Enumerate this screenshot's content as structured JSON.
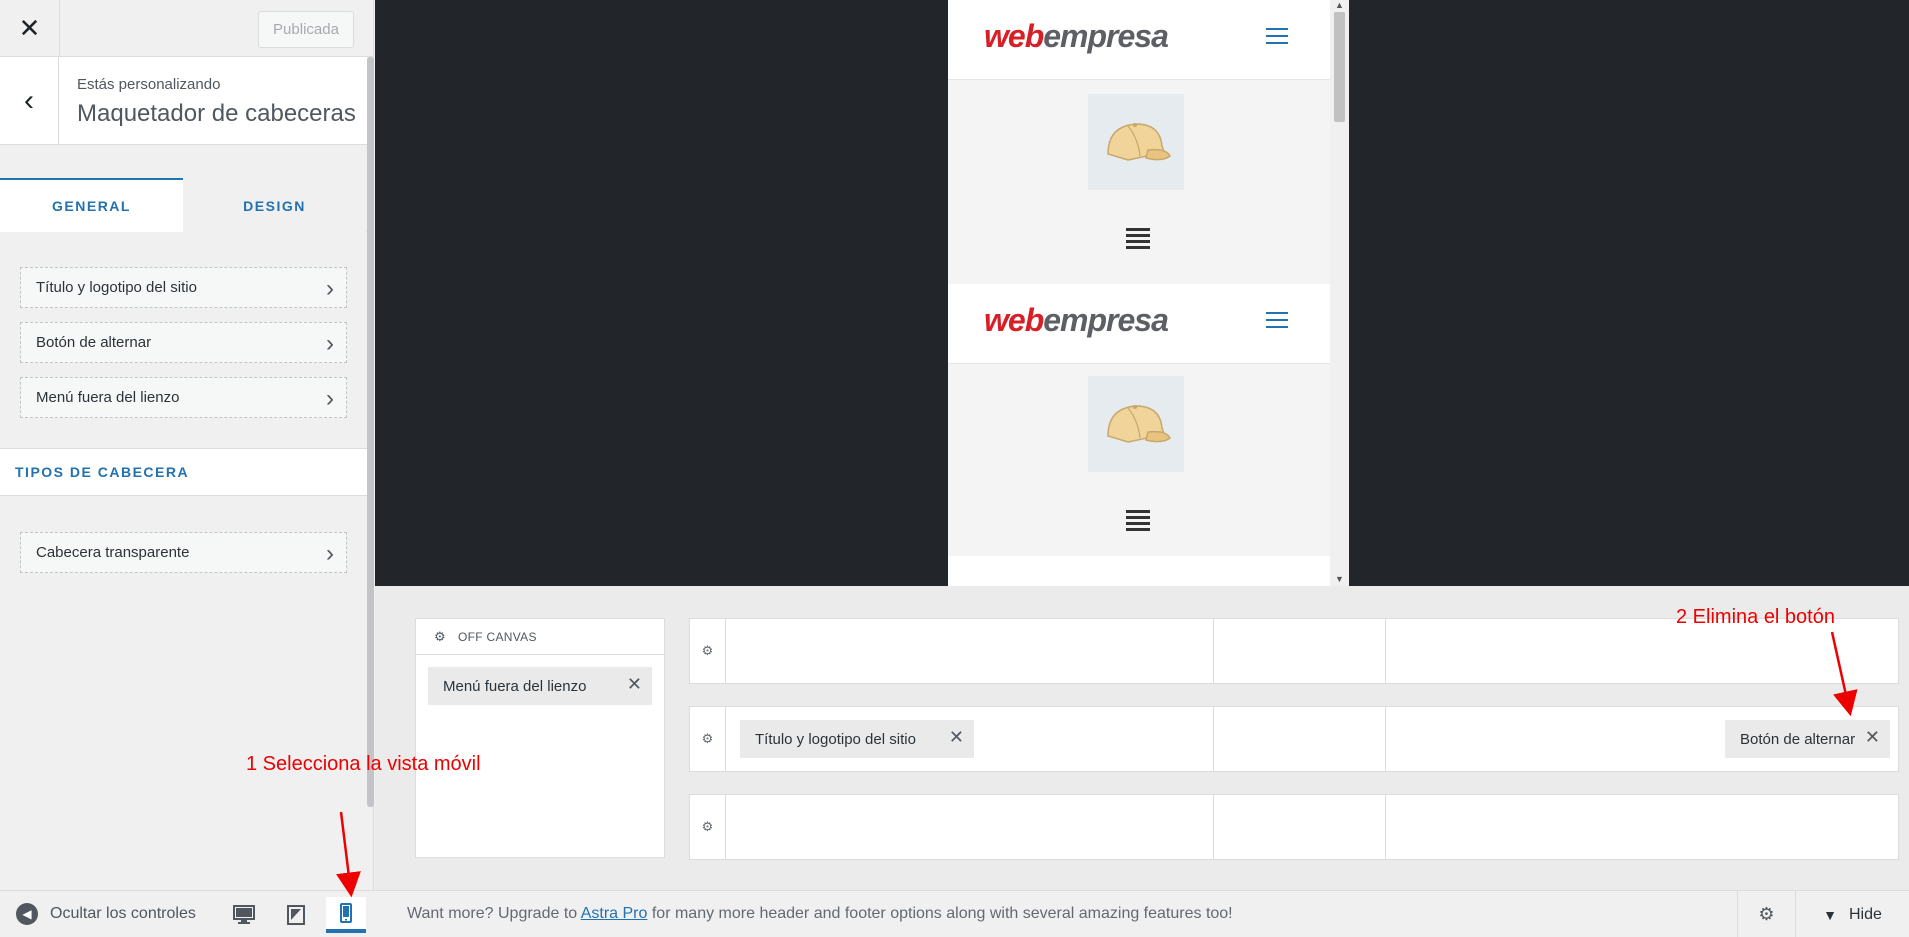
{
  "sidebar": {
    "published_label": "Publicada",
    "context_label": "Estás personalizando",
    "section_title": "Maquetador de cabeceras",
    "tabs": [
      {
        "label": "GENERAL",
        "active": true
      },
      {
        "label": "DESIGN",
        "active": false
      }
    ],
    "items": [
      {
        "label": "Título y logotipo del sitio"
      },
      {
        "label": "Botón de alternar"
      },
      {
        "label": "Menú fuera del lienzo"
      }
    ],
    "types_heading": "TIPOS DE CABECERA",
    "type_items": [
      {
        "label": "Cabecera transparente"
      }
    ]
  },
  "footer": {
    "collapse_label": "Ocultar los controles",
    "active_device": "mobile"
  },
  "preview": {
    "logo_part1": "web",
    "logo_part2": "empresa"
  },
  "builder": {
    "offcanvas_label": "OFF CANVAS",
    "offcanvas_item": "Menú fuera del lienzo",
    "main_row_left_item": "Título y logotipo del sitio",
    "main_row_right_item": "Botón de alternar"
  },
  "bottom_bar": {
    "upgrade_prefix": "Want more? Upgrade to ",
    "upgrade_link": "Astra Pro",
    "upgrade_suffix": " for many more header and footer options along with several amazing features too!",
    "hide_label": "Hide"
  },
  "annotations": {
    "step1": "1 Selecciona la vista móvil",
    "step2": "2 Elimina el botón"
  },
  "colors": {
    "accent": "#2271b1",
    "annotation": "#ee0000",
    "logo_red": "#d61f26",
    "logo_gray": "#5c5f63"
  }
}
